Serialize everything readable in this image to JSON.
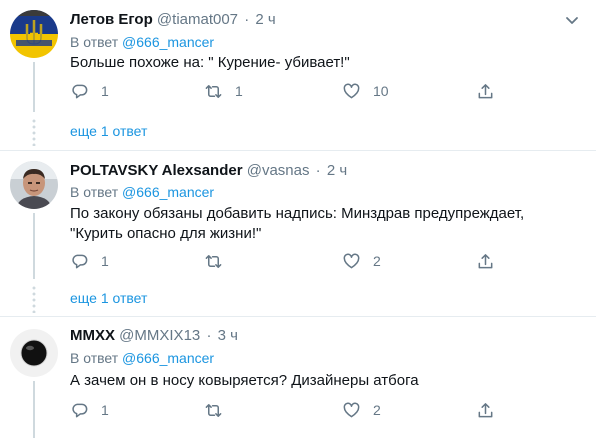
{
  "tweets": [
    {
      "name": "Летов Егор",
      "handle": "@tiamat007",
      "separator": "·",
      "time": "2 ч",
      "reply_prefix": "В ответ",
      "reply_to": "@666_mancer",
      "text": "Больше похоже на: \" Курение- убивает!\"",
      "reply_count": "1",
      "retweet_count": "1",
      "like_count": "10",
      "more_replies": "еще 1 ответ",
      "avatar_colors": {
        "top": "#1a3a8a",
        "bottom": "#f2c400",
        "trident": "#f2c400"
      }
    },
    {
      "name": "POLTAVSKY Alexsander",
      "handle": "@vasnas",
      "separator": "·",
      "time": "2 ч",
      "reply_prefix": "В ответ",
      "reply_to": "@666_mancer",
      "text_line1": "По закону обязаны добавить надпись: Минздрав предупреждает,",
      "text_line2": "\"Курить опасно для жизни!\"",
      "reply_count": "1",
      "retweet_count": "",
      "like_count": "2",
      "more_replies": "еще 1 ответ"
    },
    {
      "name": "MMXX",
      "handle": "@MMXIX13",
      "separator": "·",
      "time": "3 ч",
      "reply_prefix": "В ответ",
      "reply_to": "@666_mancer",
      "text": "А зачем он в носу ковыряется? Дизайнеры атбога",
      "reply_count": "1",
      "retweet_count": "",
      "like_count": "2"
    }
  ],
  "colors": {
    "link": "#1b95e0",
    "secondary_text": "#657786",
    "primary_text": "#0f1419",
    "divider": "#e6ecf0"
  },
  "icons": [
    "reply-icon",
    "retweet-icon",
    "like-icon",
    "share-icon",
    "chevron-down-icon"
  ]
}
